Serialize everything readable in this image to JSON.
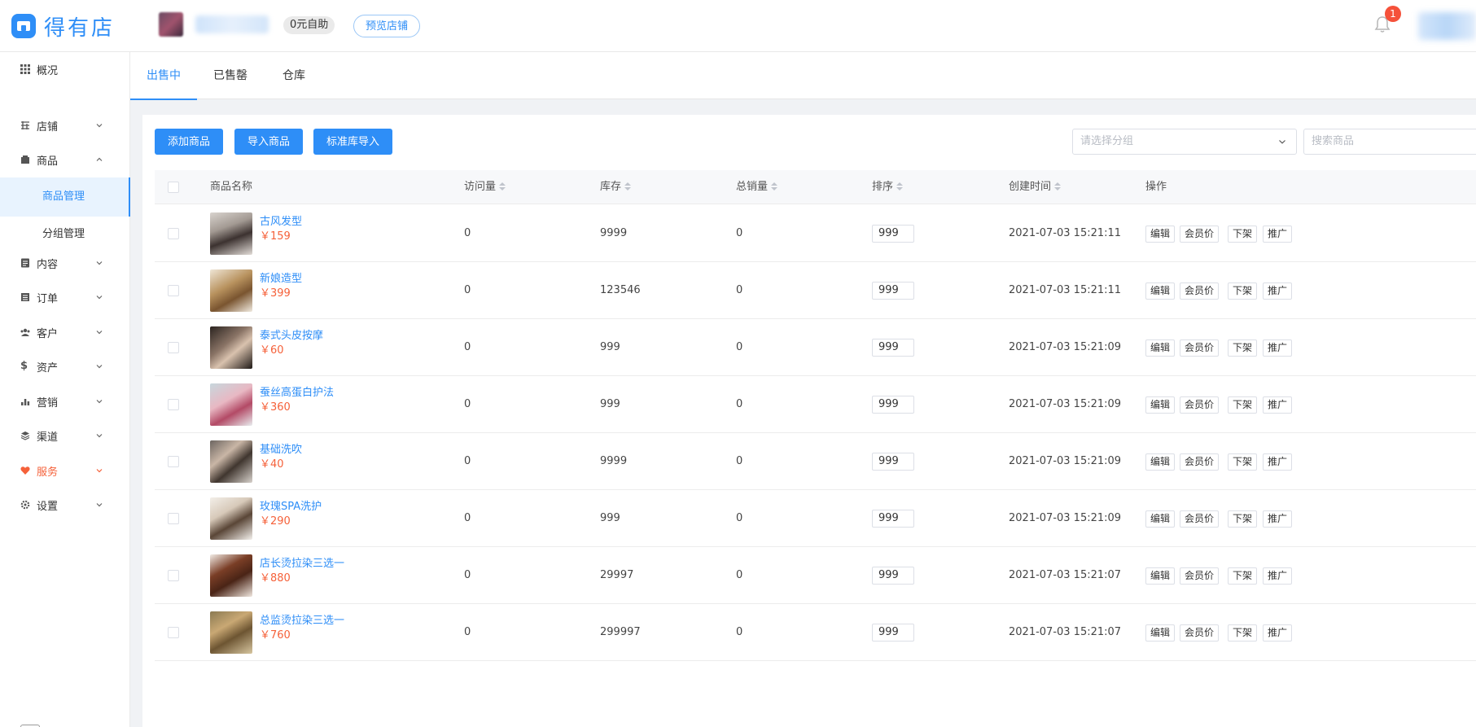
{
  "header": {
    "brand_name": "得有店",
    "free_tag": "0元自助",
    "preview_button": "预览店铺",
    "notification_count": "1"
  },
  "sidebar": {
    "items": [
      {
        "label": "概况",
        "icon": "grid-icon"
      },
      {
        "label": "店铺",
        "icon": "shop-icon"
      },
      {
        "label": "商品",
        "icon": "goods-icon"
      },
      {
        "label": "内容",
        "icon": "content-icon"
      },
      {
        "label": "订单",
        "icon": "order-icon"
      },
      {
        "label": "客户",
        "icon": "customer-icon"
      },
      {
        "label": "资产",
        "icon": "dollar-icon"
      },
      {
        "label": "营销",
        "icon": "bar-chart-icon"
      },
      {
        "label": "渠道",
        "icon": "layers-icon"
      },
      {
        "label": "服务",
        "icon": "heart-icon"
      },
      {
        "label": "设置",
        "icon": "gear-icon"
      }
    ],
    "sub_items": [
      {
        "label": "商品管理"
      },
      {
        "label": "分组管理"
      }
    ]
  },
  "tabs": [
    {
      "label": "出售中"
    },
    {
      "label": "已售罄"
    },
    {
      "label": "仓库"
    }
  ],
  "toolbar": {
    "add_goods": "添加商品",
    "import_goods": "导入商品",
    "standard_import": "标准库导入",
    "group_placeholder": "请选择分组",
    "search_placeholder": "搜索商品"
  },
  "table": {
    "columns": [
      "商品名称",
      "访问量",
      "库存",
      "总销量",
      "排序",
      "创建时间",
      "操作"
    ],
    "actions": [
      "编辑",
      "会员价",
      "下架",
      "推广"
    ],
    "rows": [
      {
        "name": "古风发型",
        "price": "￥159",
        "visits": "0",
        "stock": "9999",
        "sales": "0",
        "sort": "999",
        "created": "2021-07-03 15:21:11"
      },
      {
        "name": "新娘造型",
        "price": "￥399",
        "visits": "0",
        "stock": "123546",
        "sales": "0",
        "sort": "999",
        "created": "2021-07-03 15:21:11"
      },
      {
        "name": "泰式头皮按摩",
        "price": "￥60",
        "visits": "0",
        "stock": "999",
        "sales": "0",
        "sort": "999",
        "created": "2021-07-03 15:21:09"
      },
      {
        "name": "蚕丝高蛋白护法",
        "price": "￥360",
        "visits": "0",
        "stock": "999",
        "sales": "0",
        "sort": "999",
        "created": "2021-07-03 15:21:09"
      },
      {
        "name": "基础洗吹",
        "price": "￥40",
        "visits": "0",
        "stock": "9999",
        "sales": "0",
        "sort": "999",
        "created": "2021-07-03 15:21:09"
      },
      {
        "name": "玫瑰SPA洗护",
        "price": "￥290",
        "visits": "0",
        "stock": "999",
        "sales": "0",
        "sort": "999",
        "created": "2021-07-03 15:21:09"
      },
      {
        "name": "店长烫拉染三选一",
        "price": "￥880",
        "visits": "0",
        "stock": "29997",
        "sales": "0",
        "sort": "999",
        "created": "2021-07-03 15:21:07"
      },
      {
        "name": "总监烫拉染三选一",
        "price": "￥760",
        "visits": "0",
        "stock": "299997",
        "sales": "0",
        "sort": "999",
        "created": "2021-07-03 15:21:07"
      }
    ]
  },
  "colors": {
    "primary": "#2e8ef7",
    "price": "#f5613a",
    "service": "#f5613a",
    "badge": "#f5513a"
  }
}
